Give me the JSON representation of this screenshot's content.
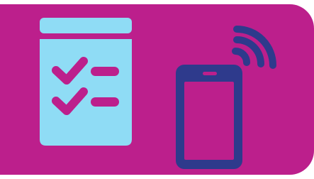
{
  "illustration": {
    "background_color": "#bc1f8c",
    "page_color": "#ffffff",
    "checklist": {
      "icon": "checklist-icon",
      "color": "#8fdcf5",
      "check_rows": 2
    },
    "phone": {
      "icon": "smartphone-icon",
      "color": "#2e3a8c",
      "screen_color": "#bc1f8c"
    },
    "signal": {
      "icon": "wireless-signal-icon",
      "color": "#2e3a8c",
      "arcs": 3
    }
  }
}
